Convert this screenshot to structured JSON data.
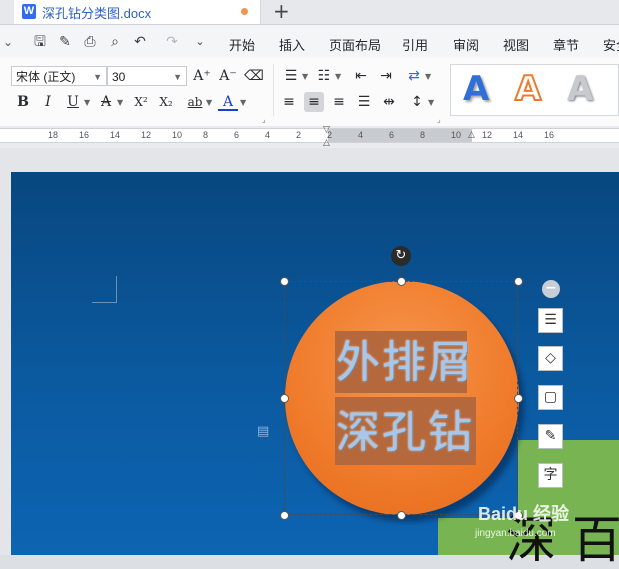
{
  "tab": {
    "title": "深孔钻分类图.docx",
    "doc_icon": "W",
    "new_tab": "+"
  },
  "menu": {
    "items": [
      "开始",
      "插入",
      "页面布局",
      "引用",
      "审阅",
      "视图",
      "章节",
      "安全"
    ],
    "quick_icons": [
      "save-icon",
      "format-painter-icon",
      "print-icon",
      "print-preview-icon",
      "undo-icon",
      "redo-icon",
      "more-icon"
    ]
  },
  "ribbon": {
    "font_name": "宋体 (正文)",
    "font_size": "30",
    "increase_font": "A⁺",
    "decrease_font": "A⁻",
    "bold": "B",
    "italic": "I",
    "underline": "U",
    "font_color_a": "A",
    "superscript": "X²",
    "subscript": "X₂",
    "char_shading": "ab",
    "font_color": "A",
    "wordart_letter": "A",
    "wordart_colors": [
      "#2f6fd6",
      "#ef7a2a",
      "#b9bcc1"
    ]
  },
  "ruler": {
    "labels": [
      "18",
      "16",
      "14",
      "12",
      "10",
      "8",
      "6",
      "4",
      "2",
      "2",
      "4",
      "6",
      "8",
      "10",
      "12",
      "14",
      "16"
    ]
  },
  "canvas": {
    "circle_text_line1": "外排屑",
    "circle_text_line2": "深孔钻",
    "big_glyph": "深 百",
    "page_color": "#0b5aa0",
    "circle_color": "#ef7a2a",
    "green_color": "#78b552"
  },
  "floating_toolbar": [
    "collapse-icon",
    "wrap-text-icon",
    "fill-icon",
    "outline-icon",
    "pen-icon",
    "text-style-icon"
  ],
  "watermark": {
    "main": "Baidu 经验",
    "sub": "jingyan.baidu.com"
  }
}
